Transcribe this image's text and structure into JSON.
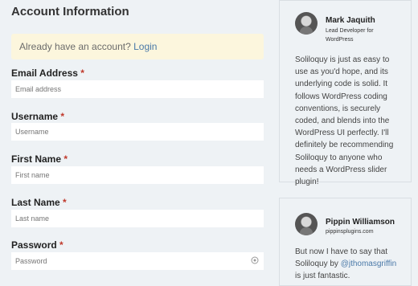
{
  "form": {
    "title": "Account Information",
    "notice": {
      "text": "Already have an account?",
      "link": "Login"
    },
    "fields": [
      {
        "label": "Email Address",
        "placeholder": "Email address",
        "required": "*"
      },
      {
        "label": "Username",
        "placeholder": "Username",
        "required": "*"
      },
      {
        "label": "First Name",
        "placeholder": "First name",
        "required": "*"
      },
      {
        "label": "Last Name",
        "placeholder": "Last name",
        "required": "*"
      },
      {
        "label": "Password",
        "placeholder": "Password",
        "required": "*"
      }
    ]
  },
  "testimonials": [
    {
      "name": "Mark Jaquith",
      "subtitle_line1": "Lead Developer for",
      "subtitle_line2": "WordPress",
      "quote": "Soliloquy is just as easy to use as you'd hope, and its underlying code is solid. It follows WordPress coding conventions, is securely coded, and blends into the WordPress UI perfectly. I'll definitely be recommending Soliloquy to anyone who needs a WordPress slider plugin!"
    },
    {
      "name": "Pippin Williamson",
      "subtitle_line1": "pippinsplugins.com",
      "quote_before": "But now I have to say that Soliloquy by ",
      "quote_mention": "@jthomasgriffin",
      "quote_after": " is just fantastic."
    }
  ],
  "colors": {
    "background": "#eef2f5",
    "notice_bg": "#fcf6dd",
    "link": "#4a79a8",
    "required": "#c0392b"
  }
}
